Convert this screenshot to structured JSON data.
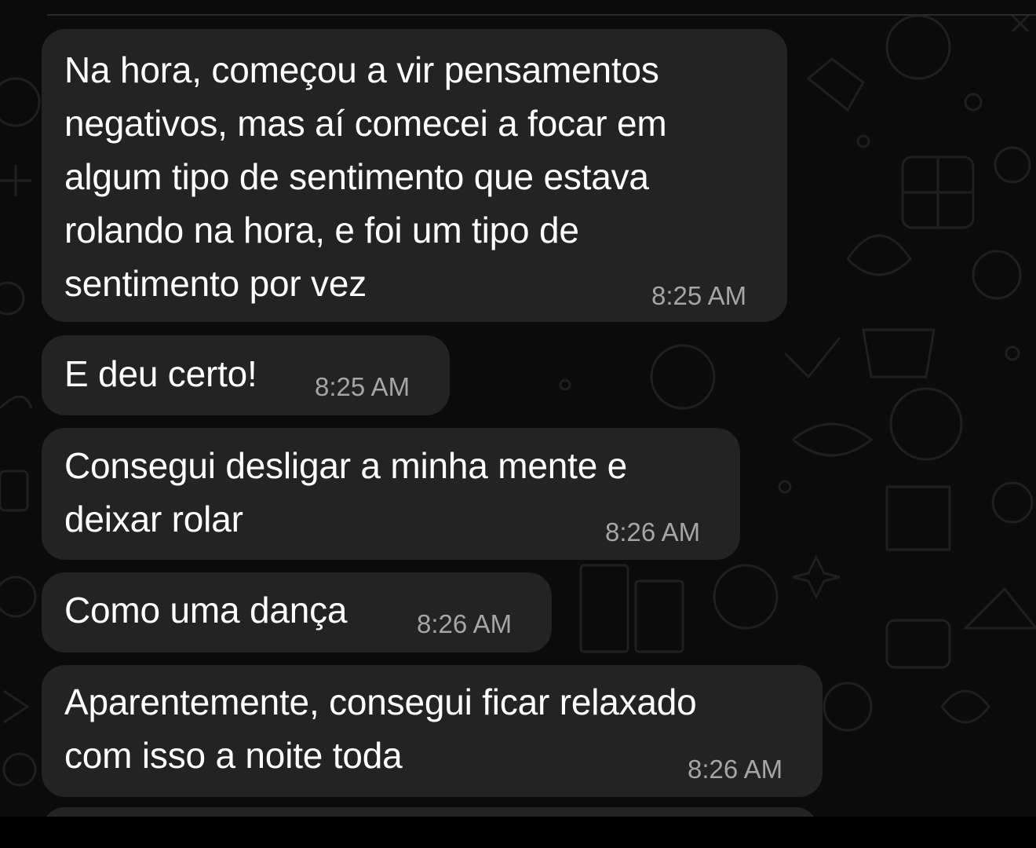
{
  "theme": {
    "background": "#0b0b0b",
    "bubble_color": "#232323",
    "text_color": "#ffffff",
    "time_color": "#a5a5a5",
    "pattern_color": "#1e1e1e"
  },
  "messages": [
    {
      "text": "Na hora, começou a vir pensamentos\nnegativos, mas aí comecei a focar em\nalgum tipo de sentimento que estava\nrolando na hora, e foi um tipo de\nsentimento por vez",
      "time": "8:25 AM"
    },
    {
      "text": "E deu certo!",
      "time": "8:25 AM"
    },
    {
      "text": "Consegui desligar a minha mente e\ndeixar rolar",
      "time": "8:26 AM"
    },
    {
      "text": "Como uma dança",
      "time": "8:26 AM"
    },
    {
      "text": "Aparentemente, consegui ficar relaxado\ncom isso a noite toda",
      "time": "8:26 AM"
    }
  ]
}
